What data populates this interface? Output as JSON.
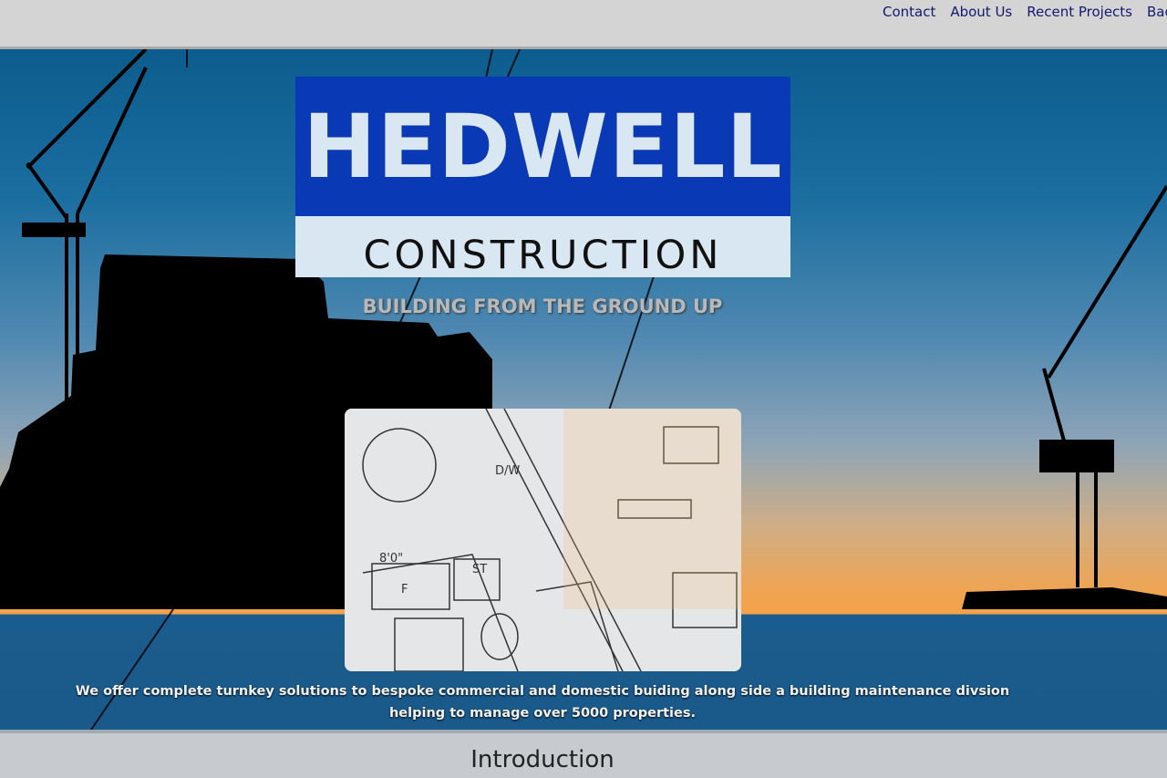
{
  "nav": {
    "items": [
      "Contact",
      "About Us",
      "Recent Projects",
      "Back"
    ]
  },
  "logo": {
    "line1": "HEDWELL",
    "line2": "CONSTRUCTION"
  },
  "hero": {
    "tagline": "BUILDING FROM THE GROUND UP",
    "description": "We offer complete turnkey solutions to bespoke commercial and domestic buiding along side a building maintenance divsion helping to manage over 5000 properties."
  },
  "intro": {
    "title": "Introduction"
  },
  "colors": {
    "nav_text": "#15186f",
    "logo_blue": "#0a39b5",
    "logo_light": "#d8e7f1"
  }
}
